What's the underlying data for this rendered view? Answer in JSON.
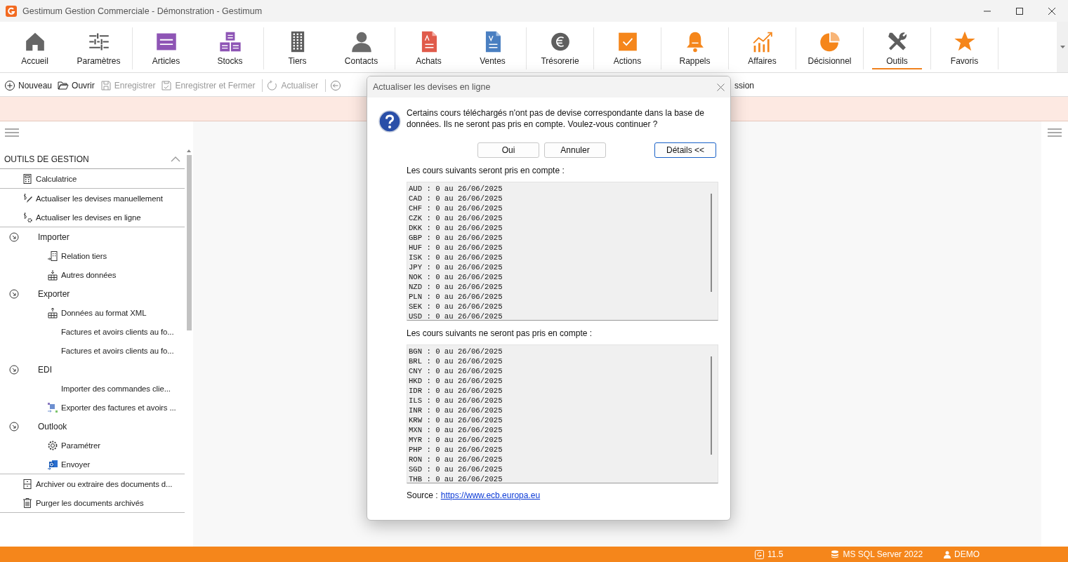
{
  "window": {
    "title": "Gestimum Gestion Commerciale - Démonstration - Gestimum"
  },
  "ribbon": {
    "groups": [
      {
        "items": [
          {
            "label": "Accueil",
            "selected": false
          },
          {
            "label": "Paramètres",
            "selected": false
          }
        ]
      },
      {
        "items": [
          {
            "label": "Articles",
            "selected": false
          },
          {
            "label": "Stocks",
            "selected": false
          }
        ]
      },
      {
        "items": [
          {
            "label": "Tiers",
            "selected": false
          },
          {
            "label": "Contacts",
            "selected": false
          }
        ]
      },
      {
        "items": [
          {
            "label": "Achats",
            "selected": false
          },
          {
            "label": "Ventes",
            "selected": false
          }
        ]
      },
      {
        "items": [
          {
            "label": "Trésorerie",
            "selected": false
          }
        ]
      },
      {
        "items": [
          {
            "label": "Actions",
            "selected": false
          }
        ]
      },
      {
        "items": [
          {
            "label": "Rappels",
            "selected": false
          }
        ]
      },
      {
        "items": [
          {
            "label": "Affaires",
            "selected": false
          }
        ]
      },
      {
        "items": [
          {
            "label": "Décisionnel",
            "selected": false
          }
        ]
      },
      {
        "items": [
          {
            "label": "Outils",
            "selected": true
          }
        ]
      },
      {
        "items": [
          {
            "label": "Favoris",
            "selected": false
          }
        ]
      }
    ]
  },
  "toolbar": {
    "items": [
      {
        "label": "Nouveau",
        "disabled": false
      },
      {
        "label": "Ouvrir",
        "disabled": false
      },
      {
        "label": "Enregistrer",
        "disabled": true
      },
      {
        "label": "Enregistrer et Fermer",
        "disabled": true
      },
      {
        "label": "Actualiser",
        "disabled": true
      }
    ],
    "cut_off_item": "ssion"
  },
  "sidebar": {
    "title": "OUTILS DE GESTION",
    "expanded": true,
    "sections": [
      {
        "items": [
          {
            "kind": "leaf",
            "label": "Calculatrice"
          }
        ]
      },
      {
        "items": [
          {
            "kind": "leaf",
            "label": "Actualiser les devises manuellement"
          },
          {
            "kind": "leaf",
            "label": "Actualiser les devises en ligne"
          }
        ]
      },
      {
        "items": [
          {
            "kind": "group",
            "label": "Importer",
            "expanded": true,
            "children": [
              {
                "kind": "leaf",
                "label": "Relation tiers"
              },
              {
                "kind": "leaf",
                "label": "Autres données"
              }
            ]
          },
          {
            "kind": "group",
            "label": "Exporter",
            "expanded": true,
            "children": [
              {
                "kind": "leaf",
                "label": "Données au format XML"
              },
              {
                "kind": "leaf",
                "label": "Factures et avoirs clients au fo..."
              },
              {
                "kind": "leaf",
                "label": "Factures et avoirs clients au fo..."
              }
            ]
          },
          {
            "kind": "group",
            "label": "EDI",
            "expanded": true,
            "children": [
              {
                "kind": "leaf",
                "label": "Importer des commandes clie..."
              },
              {
                "kind": "leaf",
                "label": "Exporter des factures et avoirs ..."
              }
            ]
          },
          {
            "kind": "group",
            "label": "Outlook",
            "expanded": true,
            "children": [
              {
                "kind": "leaf",
                "label": "Paramétrer"
              },
              {
                "kind": "leaf",
                "label": "Envoyer"
              }
            ]
          }
        ]
      },
      {
        "items": [
          {
            "kind": "leaf",
            "label": "Archiver ou extraire des documents d..."
          },
          {
            "kind": "leaf",
            "label": "Purger les documents archivés"
          }
        ]
      }
    ]
  },
  "dialog": {
    "title": "Actualiser les devises en ligne",
    "message": "Certains cours téléchargés n'ont pas de devise correspondante dans la base de données. Ils ne seront pas pris en compte. Voulez-vous continuer ?",
    "buttons": [
      {
        "label": "Oui",
        "focused": false
      },
      {
        "label": "Annuler",
        "focused": false
      },
      {
        "label": "Détails <<",
        "focused": true
      }
    ],
    "lists": [
      {
        "label": "Les cours suivants seront pris en compte :",
        "rows": [
          "AUD : 0 au 26/06/2025",
          "CAD : 0 au 26/06/2025",
          "CHF : 0 au 26/06/2025",
          "CZK : 0 au 26/06/2025",
          "DKK : 0 au 26/06/2025",
          "GBP : 0 au 26/06/2025",
          "HUF : 0 au 26/06/2025",
          "ISK : 0 au 26/06/2025",
          "JPY : 0 au 26/06/2025",
          "NOK : 0 au 26/06/2025",
          "NZD : 0 au 26/06/2025",
          "PLN : 0 au 26/06/2025",
          "SEK : 0 au 26/06/2025",
          "USD : 0 au 26/06/2025"
        ]
      },
      {
        "label": "Les cours suivants ne seront pas pris en compte :",
        "rows": [
          "BGN : 0 au 26/06/2025",
          "BRL : 0 au 26/06/2025",
          "CNY : 0 au 26/06/2025",
          "HKD : 0 au 26/06/2025",
          "IDR : 0 au 26/06/2025",
          "ILS : 0 au 26/06/2025",
          "INR : 0 au 26/06/2025",
          "KRW : 0 au 26/06/2025",
          "MXN : 0 au 26/06/2025",
          "MYR : 0 au 26/06/2025",
          "PHP : 0 au 26/06/2025",
          "RON : 0 au 26/06/2025",
          "SGD : 0 au 26/06/2025",
          "THB : 0 au 26/06/2025"
        ]
      }
    ],
    "source_label": "Source :",
    "source_link": "https://www.ecb.europa.eu"
  },
  "status_bar": {
    "version": "11.5",
    "database": "MS SQL Server 2022",
    "user": "DEMO"
  }
}
